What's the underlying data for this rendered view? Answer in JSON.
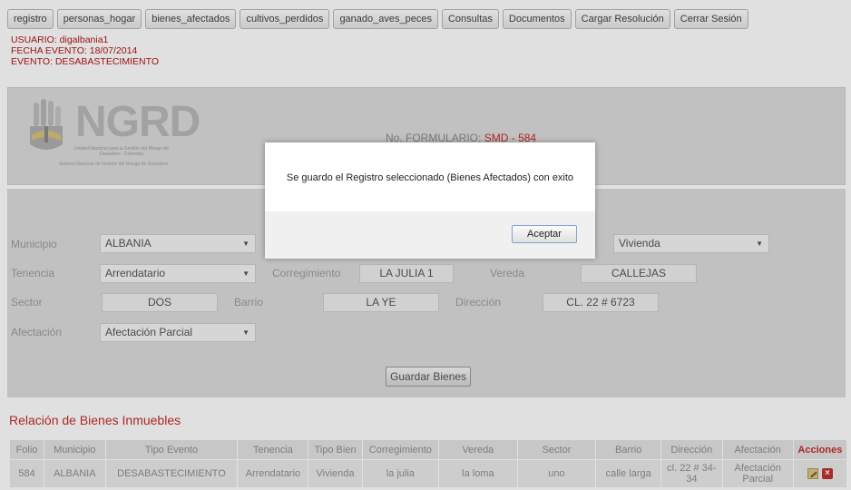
{
  "nav": {
    "items": [
      "registro",
      "personas_hogar",
      "bienes_afectados",
      "cultivos_perdidos",
      "ganado_aves_peces",
      "Consultas",
      "Documentos",
      "Cargar Resolución",
      "Cerrar Sesión"
    ]
  },
  "userinfo": {
    "usuario": "USUARIO: digalbania1",
    "fecha": "FECHA EVENTO: 18/07/2014",
    "evento": "EVENTO: DESABASTECIMIENTO"
  },
  "logo": {
    "text": "NGRD",
    "sub": "Unidad Nacional para la Gestión del Riesgo de Desastres - Colombia",
    "foot": "Sistema Nacional de Gestión del Riesgo de Desastres"
  },
  "formulario": {
    "label": "No. FORMULARIO:",
    "prefix": "SMD",
    "sep": "-",
    "number": "584"
  },
  "form": {
    "municipio_label": "Municipio",
    "municipio_value": "ALBANIA",
    "tipo_bien_value": "Vivienda",
    "tenencia_label": "Tenencia",
    "tenencia_value": "Arrendatario",
    "corregimiento_label": "Corregimiento",
    "corregimiento_value": "LA JULIA 1",
    "vereda_label": "Vereda",
    "vereda_value": "CALLEJAS",
    "sector_label": "Sector",
    "sector_value": "DOS",
    "barrio_label": "Barrio",
    "barrio_value": "LA YE",
    "direccion_label": "Dirección",
    "direccion_value": "CL. 22 # 6723",
    "afectacion_label": "Afectación",
    "afectacion_value": "Afectación Parcial",
    "save_label": "Guardar Bienes"
  },
  "relacion_title": "Relación de Bienes Inmuebles",
  "table": {
    "headers": [
      "Folio",
      "Municipio",
      "Tipo Evento",
      "Tenencia",
      "Tipo Bien",
      "Corregimiento",
      "Vereda",
      "Sector",
      "Barrio",
      "Dirección",
      "Afectación",
      "Acciones"
    ],
    "rows": [
      [
        "584",
        "ALBANIA",
        "DESABASTECIMIENTO",
        "Arrendatario",
        "Vivienda",
        "la julia",
        "la loma",
        "uno",
        "calle larga",
        "cl. 22 # 34-34",
        "Afectación Parcial"
      ]
    ]
  },
  "dialog": {
    "message": "Se guardo el Registro seleccionado (Bienes Afectados) con exito",
    "ok_label": "Aceptar"
  }
}
